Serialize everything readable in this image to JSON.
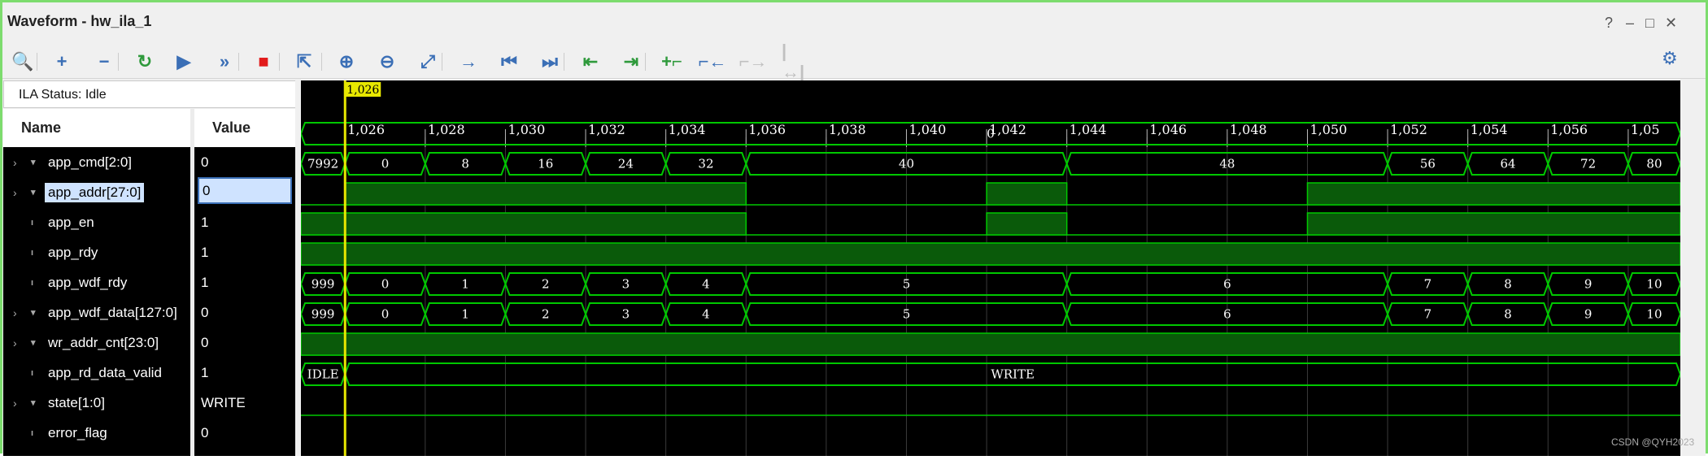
{
  "window": {
    "title": "Waveform - hw_ila_1",
    "help": "?",
    "minimize": "–",
    "maximize": "□",
    "close": "✕"
  },
  "toolbar": {
    "buttons": [
      {
        "name": "search-icon",
        "glyph": "🔍",
        "enabled": true
      },
      {
        "name": "add-icon",
        "glyph": "+",
        "enabled": true
      },
      {
        "name": "remove-icon",
        "glyph": "−",
        "enabled": true
      },
      {
        "name": "refresh-icon",
        "glyph": "↻",
        "enabled": true
      },
      {
        "name": "run-icon",
        "glyph": "▶",
        "enabled": true
      },
      {
        "name": "run-immediate-icon",
        "glyph": "»",
        "enabled": true
      },
      {
        "name": "stop-icon",
        "glyph": "■",
        "enabled": true
      },
      {
        "name": "export-icon",
        "glyph": "⇱",
        "enabled": true
      },
      {
        "name": "zoom-in-icon",
        "glyph": "⊕",
        "enabled": true
      },
      {
        "name": "zoom-out-icon",
        "glyph": "⊖",
        "enabled": true
      },
      {
        "name": "zoom-fit-icon",
        "glyph": "⤢",
        "enabled": true
      },
      {
        "name": "go-to-cursor-icon",
        "glyph": "→",
        "enabled": true
      },
      {
        "name": "go-to-start-icon",
        "glyph": "⏮",
        "enabled": true
      },
      {
        "name": "go-to-end-icon",
        "glyph": "⏭",
        "enabled": true
      },
      {
        "name": "prev-transition-icon",
        "glyph": "⇤",
        "enabled": true
      },
      {
        "name": "next-transition-icon",
        "glyph": "⇥",
        "enabled": true
      },
      {
        "name": "add-marker-icon",
        "glyph": "+⌐",
        "enabled": true
      },
      {
        "name": "prev-marker-icon",
        "glyph": "⌐←",
        "enabled": true
      },
      {
        "name": "next-marker-icon",
        "glyph": "⌐→",
        "enabled": false
      },
      {
        "name": "swap-cursors-icon",
        "glyph": "|↔|",
        "enabled": false
      }
    ],
    "settings_icon": "⚙"
  },
  "ila_status": "ILA Status:  Idle",
  "columns": {
    "name": "Name",
    "value": "Value"
  },
  "signals": [
    {
      "name": "app_cmd[2:0]",
      "value": "0",
      "bus": true
    },
    {
      "name": "app_addr[27:0]",
      "value": "0",
      "bus": true,
      "selected": true
    },
    {
      "name": "app_en",
      "value": "1",
      "bus": false
    },
    {
      "name": "app_rdy",
      "value": "1",
      "bus": false
    },
    {
      "name": "app_wdf_rdy",
      "value": "1",
      "bus": false
    },
    {
      "name": "app_wdf_data[127:0]",
      "value": "0",
      "bus": true
    },
    {
      "name": "wr_addr_cnt[23:0]",
      "value": "0",
      "bus": true
    },
    {
      "name": "app_rd_data_valid",
      "value": "1",
      "bus": false
    },
    {
      "name": "state[1:0]",
      "value": "WRITE",
      "bus": true
    },
    {
      "name": "error_flag",
      "value": "0",
      "bus": false
    }
  ],
  "timeline": {
    "cursor_label": "1,026",
    "ticks": [
      "1,026",
      "1,028",
      "1,030",
      "1,032",
      "1,034",
      "1,036",
      "1,038",
      "1,040",
      "1,042",
      "1,044",
      "1,046",
      "1,048",
      "1,050",
      "1,052",
      "1,054",
      "1,056",
      "1,05"
    ],
    "cursor_sample": 1026,
    "start_sample": 1024.9,
    "end_sample": 1059.3
  },
  "waves": {
    "app_cmd": {
      "type": "bus",
      "segments": [
        {
          "from": 1024.9,
          "to": 1059.3,
          "label": "0"
        }
      ]
    },
    "app_addr": {
      "type": "bus",
      "segments": [
        {
          "from": 1024.9,
          "to": 1026,
          "label": "7992"
        },
        {
          "from": 1026,
          "to": 1028,
          "label": "0"
        },
        {
          "from": 1028,
          "to": 1030,
          "label": "8"
        },
        {
          "from": 1030,
          "to": 1032,
          "label": "16"
        },
        {
          "from": 1032,
          "to": 1034,
          "label": "24"
        },
        {
          "from": 1034,
          "to": 1036,
          "label": "32"
        },
        {
          "from": 1036,
          "to": 1044,
          "label": "40"
        },
        {
          "from": 1044,
          "to": 1052,
          "label": "48"
        },
        {
          "from": 1052,
          "to": 1054,
          "label": "56"
        },
        {
          "from": 1054,
          "to": 1056,
          "label": "64"
        },
        {
          "from": 1056,
          "to": 1058,
          "label": "72"
        },
        {
          "from": 1058,
          "to": 1059.3,
          "label": "80"
        }
      ]
    },
    "app_en": {
      "type": "bit",
      "high": [
        [
          1026,
          1036
        ],
        [
          1042,
          1044
        ],
        [
          1050,
          1059.3
        ]
      ]
    },
    "app_rdy": {
      "type": "bit",
      "high": [
        [
          1024.9,
          1036
        ],
        [
          1042,
          1044
        ],
        [
          1050,
          1059.3
        ]
      ]
    },
    "app_wdf_rdy": {
      "type": "bit",
      "high": [
        [
          1024.9,
          1059.3
        ]
      ]
    },
    "app_wdf_data": {
      "type": "bus",
      "segments": [
        {
          "from": 1024.9,
          "to": 1026,
          "label": "999"
        },
        {
          "from": 1026,
          "to": 1028,
          "label": "0"
        },
        {
          "from": 1028,
          "to": 1030,
          "label": "1"
        },
        {
          "from": 1030,
          "to": 1032,
          "label": "2"
        },
        {
          "from": 1032,
          "to": 1034,
          "label": "3"
        },
        {
          "from": 1034,
          "to": 1036,
          "label": "4"
        },
        {
          "from": 1036,
          "to": 1044,
          "label": "5"
        },
        {
          "from": 1044,
          "to": 1052,
          "label": "6"
        },
        {
          "from": 1052,
          "to": 1054,
          "label": "7"
        },
        {
          "from": 1054,
          "to": 1056,
          "label": "8"
        },
        {
          "from": 1056,
          "to": 1058,
          "label": "9"
        },
        {
          "from": 1058,
          "to": 1059.3,
          "label": "10"
        }
      ]
    },
    "wr_addr_cnt": {
      "type": "bus",
      "segments": [
        {
          "from": 1024.9,
          "to": 1026,
          "label": "999"
        },
        {
          "from": 1026,
          "to": 1028,
          "label": "0"
        },
        {
          "from": 1028,
          "to": 1030,
          "label": "1"
        },
        {
          "from": 1030,
          "to": 1032,
          "label": "2"
        },
        {
          "from": 1032,
          "to": 1034,
          "label": "3"
        },
        {
          "from": 1034,
          "to": 1036,
          "label": "4"
        },
        {
          "from": 1036,
          "to": 1044,
          "label": "5"
        },
        {
          "from": 1044,
          "to": 1052,
          "label": "6"
        },
        {
          "from": 1052,
          "to": 1054,
          "label": "7"
        },
        {
          "from": 1054,
          "to": 1056,
          "label": "8"
        },
        {
          "from": 1056,
          "to": 1058,
          "label": "9"
        },
        {
          "from": 1058,
          "to": 1059.3,
          "label": "10"
        }
      ]
    },
    "app_rd_data_valid": {
      "type": "bit",
      "high": [
        [
          1024.9,
          1059.3
        ]
      ]
    },
    "state": {
      "type": "bus",
      "segments": [
        {
          "from": 1024.9,
          "to": 1026,
          "label": "IDLE"
        },
        {
          "from": 1026,
          "to": 1059.3,
          "label": "WRITE"
        }
      ]
    },
    "error_flag": {
      "type": "bit",
      "high": []
    }
  },
  "colors": {
    "wave": "#00c800",
    "fill": "#0a5a0a",
    "cursor": "#e8e800",
    "grid": "#3a3a3a",
    "bg": "#000000"
  },
  "watermark": "CSDN @QYH2023"
}
